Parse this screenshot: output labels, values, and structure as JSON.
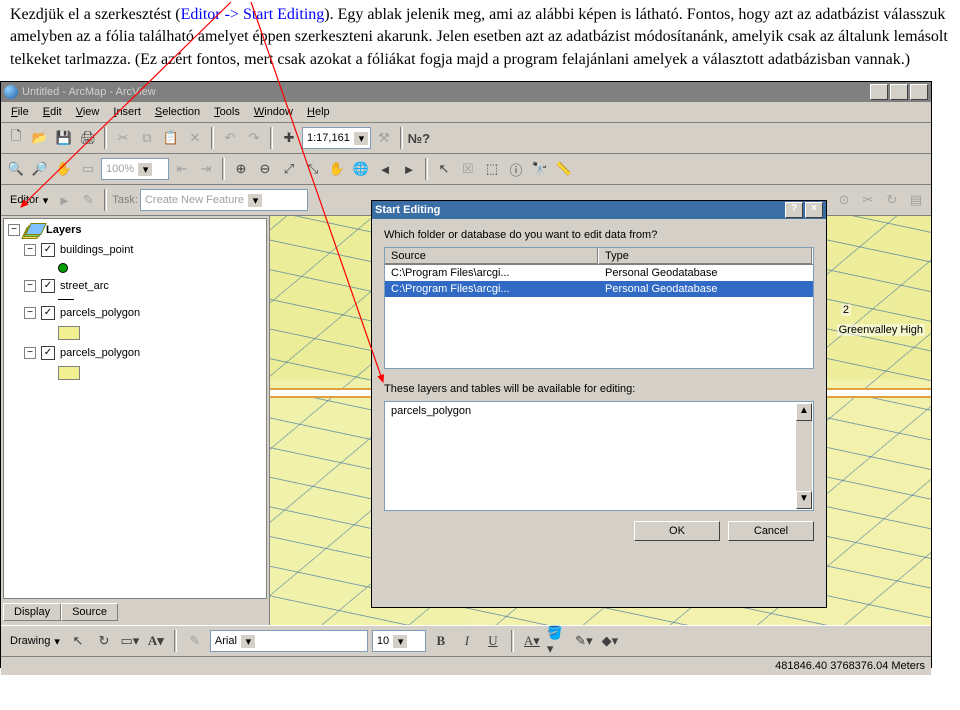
{
  "paragraph": {
    "t1": "Kezdjük el a szerkesztést (",
    "link": "Editor -> Start Editing",
    "t2": "). Egy ablak jelenik meg, ami az alábbi képen is látható. Fontos, hogy azt az adatbázist válasszuk amelyben az a fólia található amelyet éppen szerkeszteni akarunk. Jelen esetben azt az adatbázist módosítanánk, amelyik csak az általunk lemásolt telkeket tarlmazza. (Ez azért fontos, mert csak azokat a fóliákat fogja majd a program felajánlani amelyek a választott adatbázisban vannak.)"
  },
  "title": "Untitled - ArcMap - ArcView",
  "menus": {
    "file": "File",
    "edit": "Edit",
    "view": "View",
    "insert": "Insert",
    "selection": "Selection",
    "tools": "Tools",
    "window": "Window",
    "help": "Help"
  },
  "scale": "1:17,161",
  "zoom": "100%",
  "editor_label": "Editor",
  "task_label": "Task:",
  "task_value": "Create New Feature",
  "toc": {
    "root": "Layers",
    "layers": [
      {
        "name": "buildings_point"
      },
      {
        "name": "street_arc"
      },
      {
        "name": "parcels_polygon"
      },
      {
        "name": "parcels_polygon"
      }
    ],
    "tab1": "Display",
    "tab2": "Source"
  },
  "map_labels": {
    "a": "2",
    "b": "Greenvalley High"
  },
  "dialog": {
    "title": "Start Editing",
    "q": "Which folder or database do you want to edit data from?",
    "col1": "Source",
    "col2": "Type",
    "rows": [
      {
        "src": "C:\\Program Files\\arcgi...",
        "type": "Personal Geodatabase"
      },
      {
        "src": "C:\\Program Files\\arcgi...",
        "type": "Personal Geodatabase"
      }
    ],
    "mid": "These layers and tables will be available for editing:",
    "available": "parcels_polygon",
    "ok": "OK",
    "cancel": "Cancel"
  },
  "draw": {
    "label": "Drawing",
    "font": "Arial",
    "size": "10"
  },
  "status": "481846.40 3768376.04 Meters"
}
